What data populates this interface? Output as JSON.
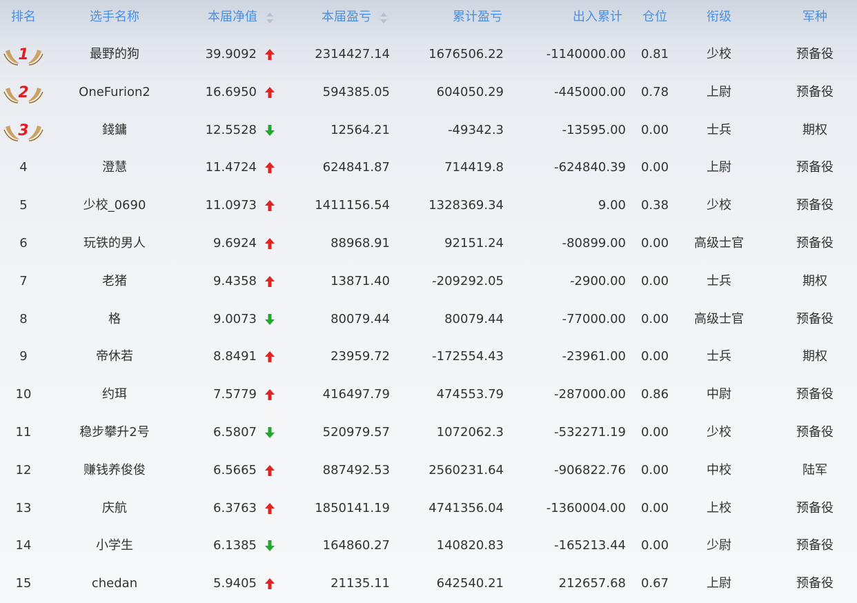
{
  "headers": {
    "rank": "排名",
    "name": "选手名称",
    "nav": "本届净值",
    "pnl": "本届盈亏",
    "cum": "累计盈亏",
    "flow": "出入累计",
    "pos": "仓位",
    "title": "衔级",
    "branch": "军种"
  },
  "colors": {
    "header_text": "#4a90e2",
    "up": "#e02424",
    "down": "#22a82f",
    "medal_number": "#e31b23",
    "wing": "#c89a52"
  },
  "rows": [
    {
      "rank": "1",
      "medal": true,
      "name": "最野的狗",
      "nav": "39.9092",
      "trend": "up",
      "pnl": "2314427.14",
      "cum": "1676506.22",
      "flow": "-1140000.00",
      "pos": "0.81",
      "title": "少校",
      "branch": "预备役"
    },
    {
      "rank": "2",
      "medal": true,
      "name": "OneFurion2",
      "nav": "16.6950",
      "trend": "up",
      "pnl": "594385.05",
      "cum": "604050.29",
      "flow": "-445000.00",
      "pos": "0.78",
      "title": "上尉",
      "branch": "预备役"
    },
    {
      "rank": "3",
      "medal": true,
      "name": "錢鏞",
      "nav": "12.5528",
      "trend": "down",
      "pnl": "12564.21",
      "cum": "-49342.3",
      "flow": "-13595.00",
      "pos": "0.00",
      "title": "士兵",
      "branch": "期权"
    },
    {
      "rank": "4",
      "medal": false,
      "name": "澄慧",
      "nav": "11.4724",
      "trend": "up",
      "pnl": "624841.87",
      "cum": "714419.8",
      "flow": "-624840.39",
      "pos": "0.00",
      "title": "上尉",
      "branch": "预备役"
    },
    {
      "rank": "5",
      "medal": false,
      "name": "少校_0690",
      "nav": "11.0973",
      "trend": "up",
      "pnl": "1411156.54",
      "cum": "1328369.34",
      "flow": "9.00",
      "pos": "0.38",
      "title": "少校",
      "branch": "预备役"
    },
    {
      "rank": "6",
      "medal": false,
      "name": "玩铁的男人",
      "nav": "9.6924",
      "trend": "up",
      "pnl": "88968.91",
      "cum": "92151.24",
      "flow": "-80899.00",
      "pos": "0.00",
      "title": "高级士官",
      "branch": "预备役"
    },
    {
      "rank": "7",
      "medal": false,
      "name": "老猪",
      "nav": "9.4358",
      "trend": "up",
      "pnl": "13871.40",
      "cum": "-209292.05",
      "flow": "-2900.00",
      "pos": "0.00",
      "title": "士兵",
      "branch": "期权"
    },
    {
      "rank": "8",
      "medal": false,
      "name": "格",
      "nav": "9.0073",
      "trend": "down",
      "pnl": "80079.44",
      "cum": "80079.44",
      "flow": "-77000.00",
      "pos": "0.00",
      "title": "高级士官",
      "branch": "预备役"
    },
    {
      "rank": "9",
      "medal": false,
      "name": "帝休若",
      "nav": "8.8491",
      "trend": "up",
      "pnl": "23959.72",
      "cum": "-172554.43",
      "flow": "-23961.00",
      "pos": "0.00",
      "title": "士兵",
      "branch": "期权"
    },
    {
      "rank": "10",
      "medal": false,
      "name": "约珥",
      "nav": "7.5779",
      "trend": "up",
      "pnl": "416497.79",
      "cum": "474553.79",
      "flow": "-287000.00",
      "pos": "0.86",
      "title": "中尉",
      "branch": "预备役"
    },
    {
      "rank": "11",
      "medal": false,
      "name": "稳步攀升2号",
      "nav": "6.5807",
      "trend": "down",
      "pnl": "520979.57",
      "cum": "1072062.3",
      "flow": "-532271.19",
      "pos": "0.00",
      "title": "少校",
      "branch": "预备役"
    },
    {
      "rank": "12",
      "medal": false,
      "name": "赚钱养俊俊",
      "nav": "6.5665",
      "trend": "up",
      "pnl": "887492.53",
      "cum": "2560231.64",
      "flow": "-906822.76",
      "pos": "0.00",
      "title": "中校",
      "branch": "陆军"
    },
    {
      "rank": "13",
      "medal": false,
      "name": "庆航",
      "nav": "6.3763",
      "trend": "up",
      "pnl": "1850141.19",
      "cum": "4741356.04",
      "flow": "-1360004.00",
      "pos": "0.00",
      "title": "上校",
      "branch": "预备役"
    },
    {
      "rank": "14",
      "medal": false,
      "name": "小学生",
      "nav": "6.1385",
      "trend": "down",
      "pnl": "164860.27",
      "cum": "140820.83",
      "flow": "-165213.44",
      "pos": "0.00",
      "title": "少尉",
      "branch": "预备役"
    },
    {
      "rank": "15",
      "medal": false,
      "name": "chedan",
      "nav": "5.9405",
      "trend": "up",
      "pnl": "21135.11",
      "cum": "642540.21",
      "flow": "212657.68",
      "pos": "0.67",
      "title": "上尉",
      "branch": "预备役"
    }
  ]
}
